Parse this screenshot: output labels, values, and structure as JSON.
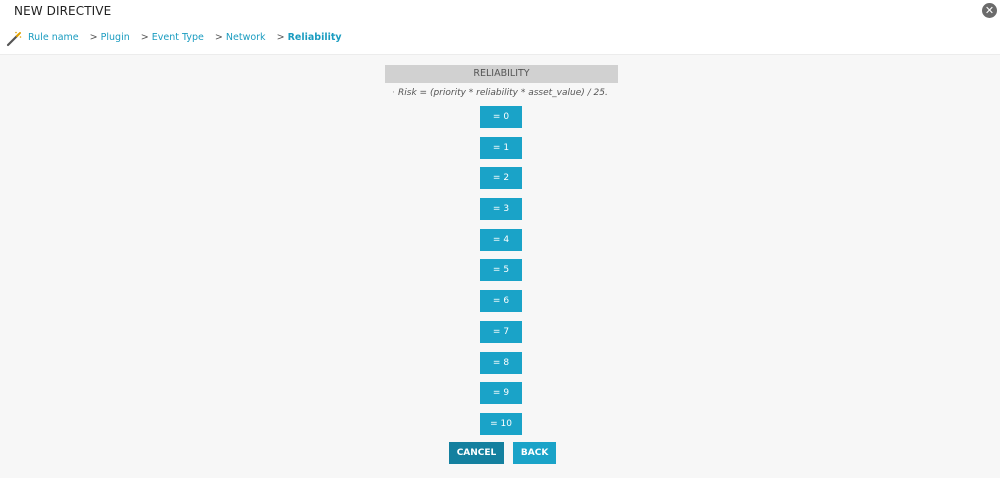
{
  "window": {
    "title": "NEW DIRECTIVE",
    "close_glyph": "✕"
  },
  "breadcrumb": {
    "separator": ">",
    "items": [
      {
        "label": "Rule name",
        "active": false
      },
      {
        "label": "Plugin",
        "active": false
      },
      {
        "label": "Event Type",
        "active": false
      },
      {
        "label": "Network",
        "active": false
      },
      {
        "label": "Reliability",
        "active": true
      }
    ]
  },
  "panel": {
    "header": "RELIABILITY",
    "formula_bullet": "·",
    "formula": "Risk = (priority * reliability * asset_value) / 25."
  },
  "options": [
    "= 0",
    "= 1",
    "= 2",
    "= 3",
    "= 4",
    "= 5",
    "= 6",
    "= 7",
    "= 8",
    "= 9",
    "= 10"
  ],
  "actions": {
    "cancel_label": "CANCEL",
    "back_label": "BACK"
  },
  "colors": {
    "accent": "#1aa3c8",
    "accent_dark": "#14809f",
    "header_bg": "#d1d1d1",
    "link": "#1a9cc0"
  }
}
